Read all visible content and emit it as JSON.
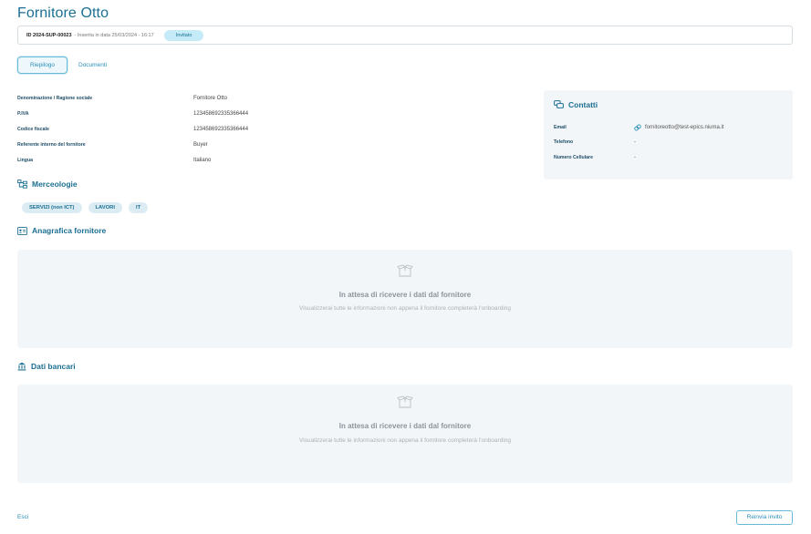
{
  "page": {
    "title": "Fornitore Otto"
  },
  "idbar": {
    "id": "ID 2024-SUP-00023",
    "date": "- Inserita in data 25/03/2024 - 16:17",
    "status": "Invitato"
  },
  "tabs": [
    {
      "label": "Riepilogo",
      "active": true
    },
    {
      "label": "Documenti",
      "active": false
    }
  ],
  "info": [
    {
      "label": "Denominazione / Ragione sociale",
      "value": "Fornitore Otto"
    },
    {
      "label": "P.IVA",
      "value": "123458692335366444"
    },
    {
      "label": "Codice fiscale",
      "value": "123458692335366444"
    },
    {
      "label": "Referente interno del fornitore",
      "value": "Buyer"
    },
    {
      "label": "Lingua",
      "value": "Italiano"
    }
  ],
  "contacts": {
    "title": "Contatti",
    "rows": [
      {
        "label": "Email",
        "value": "fornitoreotto@test-epics.niuma.it"
      },
      {
        "label": "Telefono",
        "value": "-"
      },
      {
        "label": "Numero Cellulare",
        "value": "-"
      }
    ]
  },
  "merceologie": {
    "title": "Merceologie",
    "chips": [
      "SERVIZI (non ICT)",
      "LAVORI",
      "IT"
    ]
  },
  "anagrafica": {
    "title": "Anagrafica fornitore",
    "empty_title": "In attesa di ricevere i dati dal fornitore",
    "empty_sub": "Visualizzerai tutte le informazioni non appena il fornitore completerà l'onboarding"
  },
  "bancari": {
    "title": "Dati bancari",
    "empty_title": "In attesa di ricevere i dati dal fornitore",
    "empty_sub": "Visualizzerai tutte le informazioni non appena il fornitore completerà l'onboarding"
  },
  "footer": {
    "exit_label": "Esci",
    "resend_label": "Reinvia invito"
  },
  "colors": {
    "accent": "#1b6f93",
    "link": "#2a8fb8",
    "panel": "#f3f6f8",
    "badge": "#c4ebf7"
  },
  "icons": [
    "chat-bubbles-icon",
    "link-icon",
    "hierarchy-icon",
    "id-card-icon",
    "bank-icon",
    "open-box-icon"
  ]
}
